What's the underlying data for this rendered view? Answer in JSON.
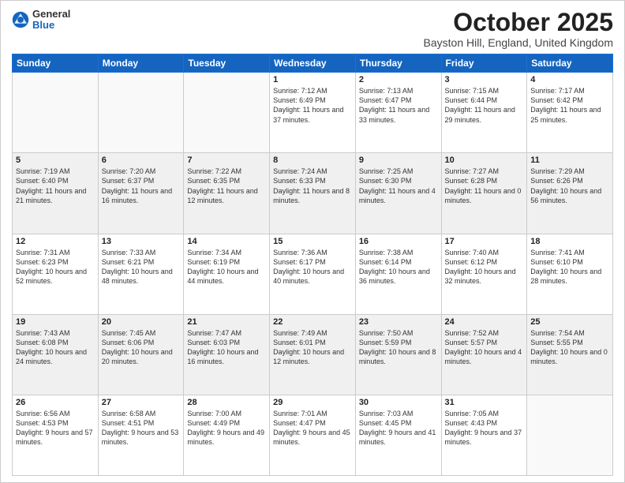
{
  "header": {
    "logo_general": "General",
    "logo_blue": "Blue",
    "month_title": "October 2025",
    "location": "Bayston Hill, England, United Kingdom"
  },
  "days_of_week": [
    "Sunday",
    "Monday",
    "Tuesday",
    "Wednesday",
    "Thursday",
    "Friday",
    "Saturday"
  ],
  "weeks": [
    [
      {
        "day": "",
        "info": ""
      },
      {
        "day": "",
        "info": ""
      },
      {
        "day": "",
        "info": ""
      },
      {
        "day": "1",
        "info": "Sunrise: 7:12 AM\nSunset: 6:49 PM\nDaylight: 11 hours and 37 minutes."
      },
      {
        "day": "2",
        "info": "Sunrise: 7:13 AM\nSunset: 6:47 PM\nDaylight: 11 hours and 33 minutes."
      },
      {
        "day": "3",
        "info": "Sunrise: 7:15 AM\nSunset: 6:44 PM\nDaylight: 11 hours and 29 minutes."
      },
      {
        "day": "4",
        "info": "Sunrise: 7:17 AM\nSunset: 6:42 PM\nDaylight: 11 hours and 25 minutes."
      }
    ],
    [
      {
        "day": "5",
        "info": "Sunrise: 7:19 AM\nSunset: 6:40 PM\nDaylight: 11 hours and 21 minutes."
      },
      {
        "day": "6",
        "info": "Sunrise: 7:20 AM\nSunset: 6:37 PM\nDaylight: 11 hours and 16 minutes."
      },
      {
        "day": "7",
        "info": "Sunrise: 7:22 AM\nSunset: 6:35 PM\nDaylight: 11 hours and 12 minutes."
      },
      {
        "day": "8",
        "info": "Sunrise: 7:24 AM\nSunset: 6:33 PM\nDaylight: 11 hours and 8 minutes."
      },
      {
        "day": "9",
        "info": "Sunrise: 7:25 AM\nSunset: 6:30 PM\nDaylight: 11 hours and 4 minutes."
      },
      {
        "day": "10",
        "info": "Sunrise: 7:27 AM\nSunset: 6:28 PM\nDaylight: 11 hours and 0 minutes."
      },
      {
        "day": "11",
        "info": "Sunrise: 7:29 AM\nSunset: 6:26 PM\nDaylight: 10 hours and 56 minutes."
      }
    ],
    [
      {
        "day": "12",
        "info": "Sunrise: 7:31 AM\nSunset: 6:23 PM\nDaylight: 10 hours and 52 minutes."
      },
      {
        "day": "13",
        "info": "Sunrise: 7:33 AM\nSunset: 6:21 PM\nDaylight: 10 hours and 48 minutes."
      },
      {
        "day": "14",
        "info": "Sunrise: 7:34 AM\nSunset: 6:19 PM\nDaylight: 10 hours and 44 minutes."
      },
      {
        "day": "15",
        "info": "Sunrise: 7:36 AM\nSunset: 6:17 PM\nDaylight: 10 hours and 40 minutes."
      },
      {
        "day": "16",
        "info": "Sunrise: 7:38 AM\nSunset: 6:14 PM\nDaylight: 10 hours and 36 minutes."
      },
      {
        "day": "17",
        "info": "Sunrise: 7:40 AM\nSunset: 6:12 PM\nDaylight: 10 hours and 32 minutes."
      },
      {
        "day": "18",
        "info": "Sunrise: 7:41 AM\nSunset: 6:10 PM\nDaylight: 10 hours and 28 minutes."
      }
    ],
    [
      {
        "day": "19",
        "info": "Sunrise: 7:43 AM\nSunset: 6:08 PM\nDaylight: 10 hours and 24 minutes."
      },
      {
        "day": "20",
        "info": "Sunrise: 7:45 AM\nSunset: 6:06 PM\nDaylight: 10 hours and 20 minutes."
      },
      {
        "day": "21",
        "info": "Sunrise: 7:47 AM\nSunset: 6:03 PM\nDaylight: 10 hours and 16 minutes."
      },
      {
        "day": "22",
        "info": "Sunrise: 7:49 AM\nSunset: 6:01 PM\nDaylight: 10 hours and 12 minutes."
      },
      {
        "day": "23",
        "info": "Sunrise: 7:50 AM\nSunset: 5:59 PM\nDaylight: 10 hours and 8 minutes."
      },
      {
        "day": "24",
        "info": "Sunrise: 7:52 AM\nSunset: 5:57 PM\nDaylight: 10 hours and 4 minutes."
      },
      {
        "day": "25",
        "info": "Sunrise: 7:54 AM\nSunset: 5:55 PM\nDaylight: 10 hours and 0 minutes."
      }
    ],
    [
      {
        "day": "26",
        "info": "Sunrise: 6:56 AM\nSunset: 4:53 PM\nDaylight: 9 hours and 57 minutes."
      },
      {
        "day": "27",
        "info": "Sunrise: 6:58 AM\nSunset: 4:51 PM\nDaylight: 9 hours and 53 minutes."
      },
      {
        "day": "28",
        "info": "Sunrise: 7:00 AM\nSunset: 4:49 PM\nDaylight: 9 hours and 49 minutes."
      },
      {
        "day": "29",
        "info": "Sunrise: 7:01 AM\nSunset: 4:47 PM\nDaylight: 9 hours and 45 minutes."
      },
      {
        "day": "30",
        "info": "Sunrise: 7:03 AM\nSunset: 4:45 PM\nDaylight: 9 hours and 41 minutes."
      },
      {
        "day": "31",
        "info": "Sunrise: 7:05 AM\nSunset: 4:43 PM\nDaylight: 9 hours and 37 minutes."
      },
      {
        "day": "",
        "info": ""
      }
    ]
  ]
}
